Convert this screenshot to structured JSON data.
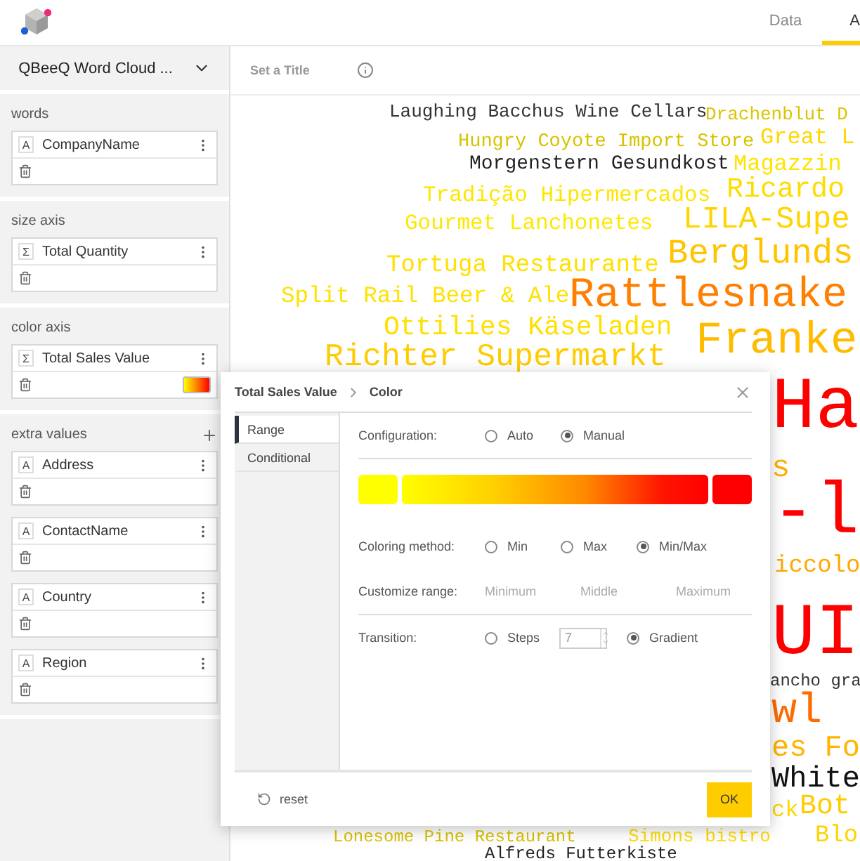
{
  "header": {
    "tabs": [
      {
        "label": "Data",
        "selected": false
      },
      {
        "label": "A",
        "selected": true
      }
    ]
  },
  "sidebar": {
    "title": "QBeeQ Word Cloud ...",
    "sections": [
      {
        "label": "words",
        "addable": false,
        "fields": [
          {
            "type": "A",
            "name": "CompanyName",
            "kind": "plain"
          }
        ]
      },
      {
        "label": "size axis",
        "addable": false,
        "fields": [
          {
            "type": "Σ",
            "name": "Total Quantity",
            "kind": "plain"
          }
        ]
      },
      {
        "label": "color axis",
        "addable": false,
        "fields": [
          {
            "type": "Σ",
            "name": "Total Sales Value",
            "kind": "color"
          }
        ]
      },
      {
        "label": "extra values",
        "addable": true,
        "fields": [
          {
            "type": "A",
            "name": "Address",
            "kind": "plain"
          },
          {
            "type": "A",
            "name": "ContactName",
            "kind": "plain"
          },
          {
            "type": "A",
            "name": "Country",
            "kind": "plain"
          },
          {
            "type": "A",
            "name": "Region",
            "kind": "plain"
          }
        ]
      }
    ]
  },
  "chart": {
    "title": "Set a Title",
    "words": [
      {
        "text": "Laughing Bacchus Wine Cellars",
        "color": "#333333"
      },
      {
        "text": "Drachenblut D",
        "color": "#dcc400"
      },
      {
        "text": "Hungry Coyote Import Store",
        "color": "#d8c200"
      },
      {
        "text": "Great L",
        "color": "#ffd800"
      },
      {
        "text": "Morgenstern Gesundkost",
        "color": "#222222"
      },
      {
        "text": "Magazzin",
        "color": "#ffe400"
      },
      {
        "text": "Tradição Hipermercados",
        "color": "#ffe600"
      },
      {
        "text": "Ricardo",
        "color": "#ffdc00"
      },
      {
        "text": "Gourmet Lanchonetes",
        "color": "#ffe800"
      },
      {
        "text": "LILA-Supe",
        "color": "#ffd400"
      },
      {
        "text": "Tortuga Restaurante",
        "color": "#ffe000"
      },
      {
        "text": "Berglunds",
        "color": "#ffc400"
      },
      {
        "text": "Split Rail Beer & Ale",
        "color": "#ffe200"
      },
      {
        "text": "Rattlesnake",
        "color": "#ff7f00"
      },
      {
        "text": "Ottilies Käseladen",
        "color": "#ffe000"
      },
      {
        "text": "Franke",
        "color": "#ffbb00"
      },
      {
        "text": "Richter Supermarkt",
        "color": "#ffcc00"
      },
      {
        "text": "Ha",
        "color": "#ff0000"
      },
      {
        "text": "s",
        "color": "#ffb000"
      },
      {
        "text": "-l",
        "color": "#ff0000"
      },
      {
        "text": "iccolo",
        "color": "#ffa800"
      },
      {
        "text": "UI",
        "color": "#ff0000"
      },
      {
        "text": "ancho gra",
        "color": "#333333"
      },
      {
        "text": "wl",
        "color": "#ff6a00"
      },
      {
        "text": "es Fo",
        "color": "#ffb400"
      },
      {
        "text": "White",
        "color": "#111111"
      },
      {
        "text": "ck",
        "color": "#ffd800"
      },
      {
        "text": "Bot",
        "color": "#ffcc00"
      },
      {
        "text": "Lonesome Pine Restaurant",
        "color": "#d8c200"
      },
      {
        "text": "Simons bistro",
        "color": "#ffdc00"
      },
      {
        "text": "Blo",
        "color": "#ffd400"
      },
      {
        "text": "Alfreds Futterkiste",
        "color": "#222222"
      }
    ]
  },
  "dialog": {
    "breadcrumb": [
      "Total Sales Value",
      "Color"
    ],
    "tabs": [
      {
        "label": "Range",
        "selected": true
      },
      {
        "label": "Conditional",
        "selected": false
      }
    ],
    "configuration": {
      "label": "Configuration:",
      "options": [
        {
          "label": "Auto",
          "selected": false
        },
        {
          "label": "Manual",
          "selected": true
        }
      ]
    },
    "coloring_method": {
      "label": "Coloring method:",
      "options": [
        {
          "label": "Min",
          "selected": false
        },
        {
          "label": "Max",
          "selected": false
        },
        {
          "label": "Min/Max",
          "selected": true
        }
      ]
    },
    "customize_range": {
      "label": "Customize range:",
      "fields": [
        {
          "placeholder": "Minimum"
        },
        {
          "placeholder": "Middle"
        },
        {
          "placeholder": "Maximum"
        }
      ]
    },
    "transition": {
      "label": "Transition:",
      "options": [
        {
          "label": "Steps",
          "selected": false,
          "kind": "steps",
          "value": "7"
        },
        {
          "label": "Gradient",
          "selected": true,
          "kind": "plain"
        }
      ]
    },
    "reset": "reset",
    "ok": "OK"
  }
}
